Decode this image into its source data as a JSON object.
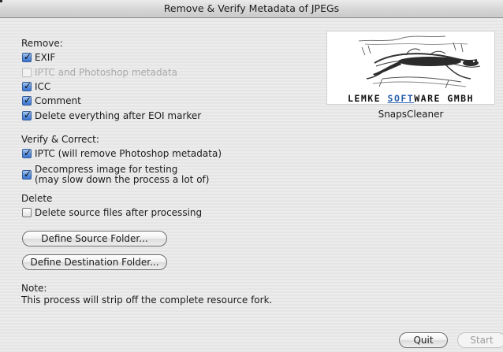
{
  "window": {
    "title": "Remove & Verify Metadata of JPEGs"
  },
  "remove": {
    "heading": "Remove:",
    "options": [
      {
        "label": "EXIF",
        "checked": true,
        "enabled": true
      },
      {
        "label": "IPTC and Photoshop metadata",
        "checked": false,
        "enabled": false
      },
      {
        "label": "ICC",
        "checked": true,
        "enabled": true
      },
      {
        "label": "Comment",
        "checked": true,
        "enabled": true
      },
      {
        "label": "Delete everything after EOI marker",
        "checked": true,
        "enabled": true
      }
    ]
  },
  "verify": {
    "heading": "Verify & Correct:",
    "options": [
      {
        "label": "IPTC (will remove Photoshop metadata)",
        "checked": true,
        "enabled": true
      },
      {
        "label_line1": "Decompress image for testing",
        "label_line2": "(may slow down the process a lot of)",
        "checked": true,
        "enabled": true
      }
    ]
  },
  "delete": {
    "heading": "Delete",
    "options": [
      {
        "label": "Delete source files after processing",
        "checked": false,
        "enabled": true
      }
    ]
  },
  "buttons": {
    "source": "Define Source Folder...",
    "destination": "Define Destination Folder...",
    "quit": "Quit",
    "start": "Start"
  },
  "note": {
    "heading": "Note:",
    "text": "This process will strip off the complete resource fork."
  },
  "logo": {
    "company_part1": "LEMKE ",
    "company_part2": "SOFT",
    "company_part3": "WARE GMBH",
    "product": "SnapsCleaner",
    "accent_color": "#2a5fb0"
  }
}
